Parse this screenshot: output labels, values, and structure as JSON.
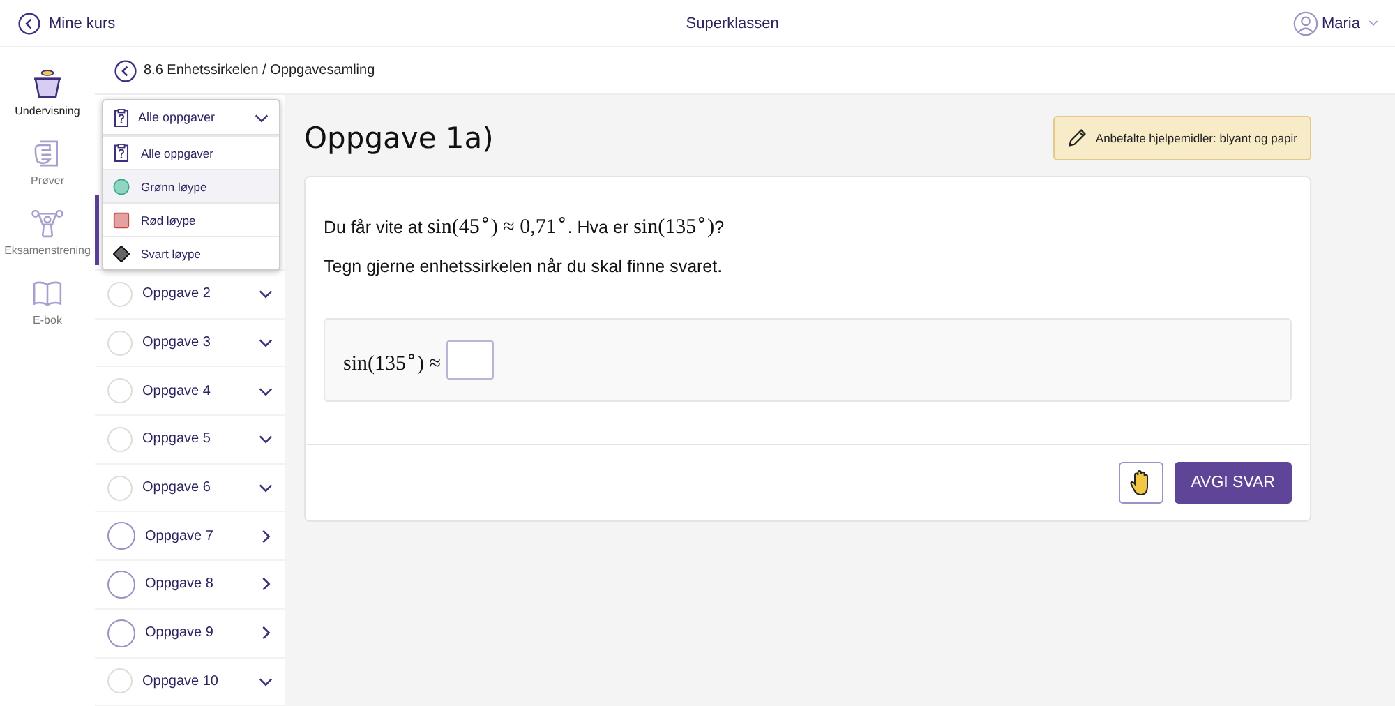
{
  "top_bar": {
    "back_label": "Mine kurs",
    "title": "Superklassen",
    "user": "Maria"
  },
  "nav": [
    {
      "label": "Undervisning",
      "selected": true
    },
    {
      "label": "Prøver",
      "selected": false
    },
    {
      "label": "Eksamenstrening",
      "selected": false
    },
    {
      "label": "E-bok",
      "selected": false
    }
  ],
  "breadcrumb": "8.6 Enhetssirkelen / Oppgavesamling",
  "filter": {
    "value": "Alle oppgaver",
    "expanded": true,
    "options": [
      {
        "label": "Alle oppgaver",
        "highlighted": false
      },
      {
        "label": "Grønn løype",
        "highlighted": true
      },
      {
        "label": "Rød løype",
        "highlighted": false
      },
      {
        "label": "Svart løype",
        "highlighted": false
      }
    ]
  },
  "tasks": [
    {
      "label": "Oppgave 2",
      "kind": "collapsible"
    },
    {
      "label": "Oppgave 3",
      "kind": "collapsible"
    },
    {
      "label": "Oppgave 4",
      "kind": "collapsible"
    },
    {
      "label": "Oppgave 5",
      "kind": "collapsible"
    },
    {
      "label": "Oppgave 6",
      "kind": "collapsible"
    },
    {
      "label": "Oppgave 7",
      "kind": "link"
    },
    {
      "label": "Oppgave 8",
      "kind": "link"
    },
    {
      "label": "Oppgave 9",
      "kind": "link"
    },
    {
      "label": "Oppgave 10",
      "kind": "collapsible"
    }
  ],
  "task": {
    "title": "Oppgave 1a)",
    "aids": "Anbefalte hjelpemidler: blyant og papir",
    "question": [
      {
        "kind": "text",
        "text": "Du får vite at "
      },
      {
        "kind": "math",
        "text": "sin(45$^{∘}$) ≈ 0,71$^{∘}$"
      },
      {
        "kind": "text",
        "text": ". Hva er "
      },
      {
        "kind": "math",
        "text": "sin(135$^{∘}$)"
      },
      {
        "kind": "text",
        "text": "?"
      }
    ],
    "hint": "Tegn gjerne enhetssirkelen når du skal finne svaret.",
    "answer_label": "sin(135$^{∘}$) ≈",
    "submit": "AVGI SVAR"
  }
}
